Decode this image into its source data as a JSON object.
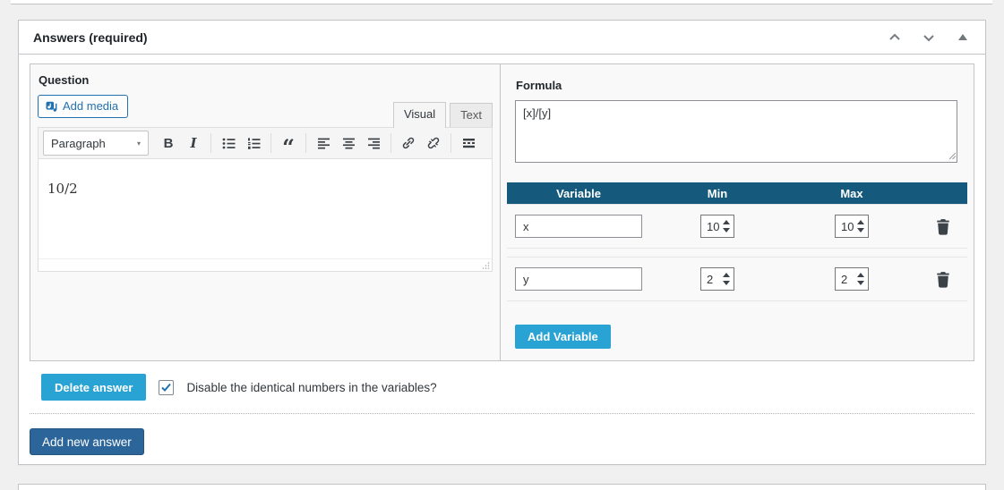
{
  "metabox": {
    "title": "Answers (required)",
    "controls": {
      "move_up_icon": "chevron-up",
      "move_down_icon": "chevron-down",
      "toggle_icon": "triangle-up"
    }
  },
  "question": {
    "label": "Question",
    "add_media_label": "Add media",
    "tabs": [
      {
        "label": "Visual",
        "active": true
      },
      {
        "label": "Text",
        "active": false
      }
    ],
    "toolbar": {
      "paragraph_label": "Paragraph",
      "buttons": [
        "bold",
        "italic",
        "bullet-list",
        "numbered-list",
        "blockquote",
        "align-left",
        "align-center",
        "align-right",
        "link",
        "unlink",
        "toolbar-toggle"
      ]
    },
    "content": "10/2"
  },
  "formula": {
    "label": "Formula",
    "value": "[x]/[y]",
    "table": {
      "headers": {
        "variable": "Variable",
        "min": "Min",
        "max": "Max"
      },
      "rows": [
        {
          "variable": "x",
          "min": "10",
          "max": "10"
        },
        {
          "variable": "y",
          "min": "2",
          "max": "2"
        }
      ]
    },
    "add_variable_label": "Add Variable"
  },
  "footer": {
    "delete_answer_label": "Delete answer",
    "checkbox_checked": true,
    "checkbox_label": "Disable the identical numbers in the variables?",
    "add_new_answer_label": "Add new answer"
  },
  "icons": {
    "bold": "B",
    "italic": "I",
    "blockquote": "“",
    "caret_down": "▾"
  },
  "colors": {
    "table_header": "#155a7d",
    "cyan_button": "#29a3d4",
    "primary_button": "#2b6599",
    "page_background": "#f0f0f1",
    "box_border": "#c3c4c7"
  }
}
